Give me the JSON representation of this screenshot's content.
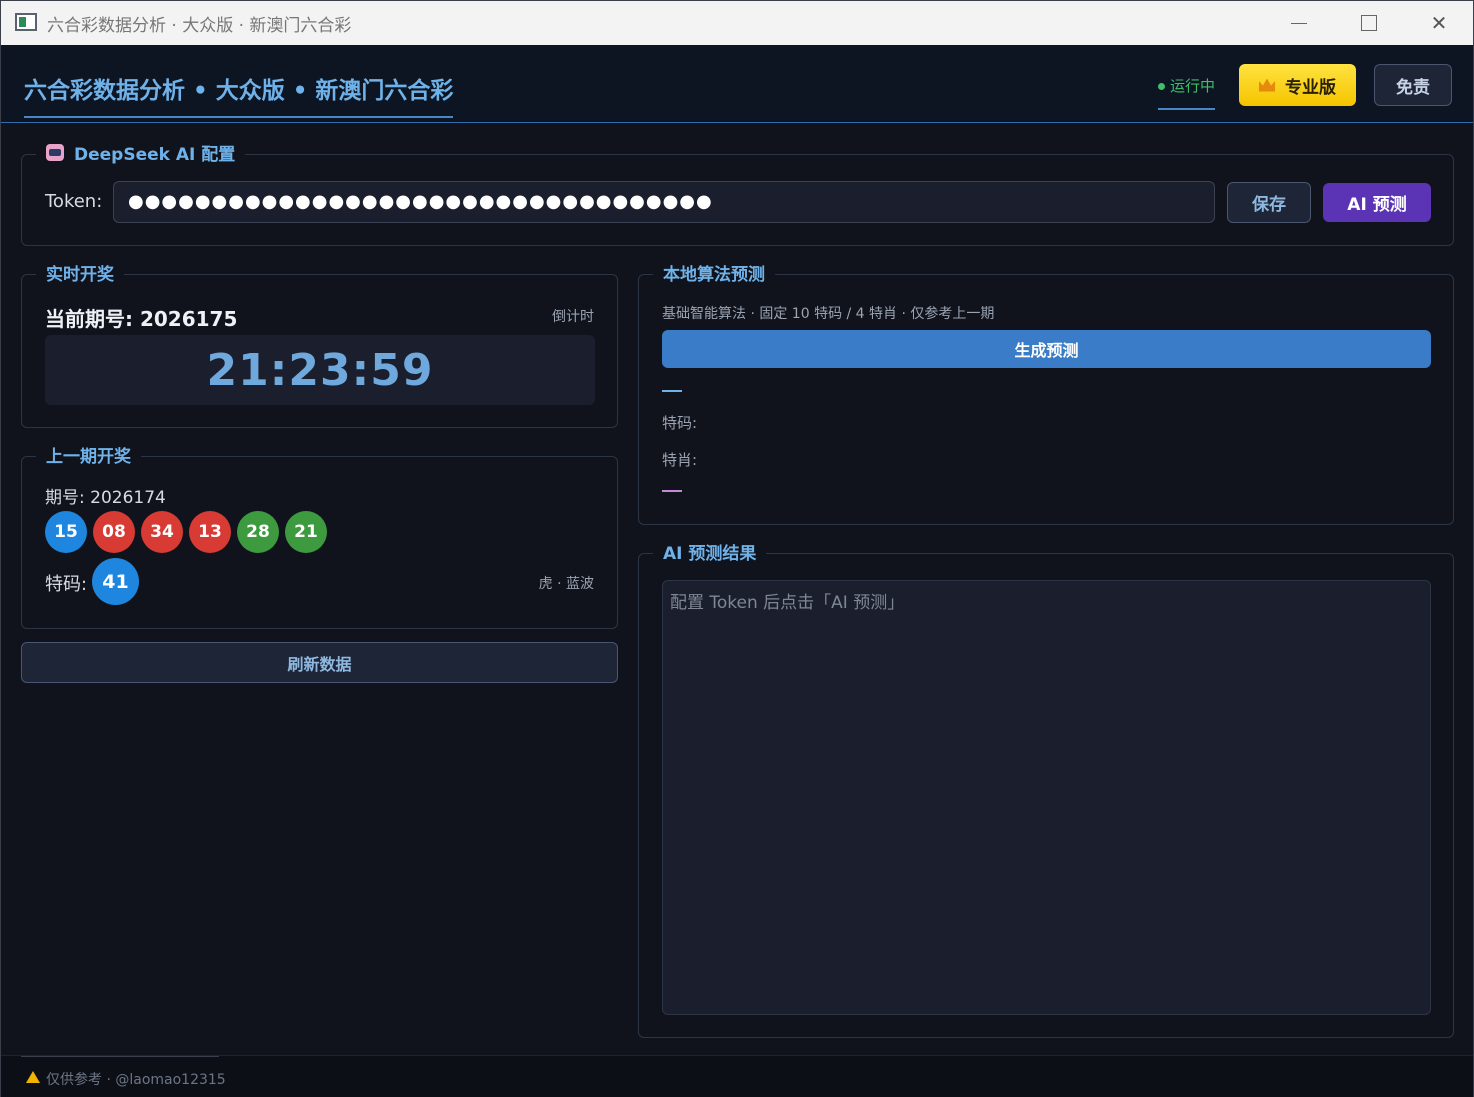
{
  "window": {
    "title": "六合彩数据分析 · 大众版 · 新澳门六合彩"
  },
  "header": {
    "title": "六合彩数据分析 • 大众版 • 新澳门六合彩",
    "status": "运行中",
    "pro_label": "专业版",
    "disclaimer_label": "免责"
  },
  "ai_config": {
    "title": "DeepSeek AI 配置",
    "token_label": "Token:",
    "token_value": "●●●●●●●●●●●●●●●●●●●●●●●●●●●●●●●●●●●",
    "save_label": "保存",
    "predict_label": "AI 预测"
  },
  "realtime": {
    "title": "实时开奖",
    "current_issue": "当前期号: 2026175",
    "countdown_label": "倒计时",
    "countdown": "21:23:59"
  },
  "last_draw": {
    "title": "上一期开奖",
    "issue": "期号: 2026174",
    "balls": [
      {
        "number": "15",
        "color": "#1e86de"
      },
      {
        "number": "08",
        "color": "#d83a34"
      },
      {
        "number": "34",
        "color": "#d83a34"
      },
      {
        "number": "13",
        "color": "#d83a34"
      },
      {
        "number": "28",
        "color": "#3e9a3e"
      },
      {
        "number": "21",
        "color": "#3e9a3e"
      }
    ],
    "special_label": "特码:",
    "special_number": "41",
    "special_color": "#1e86de",
    "zodiac": "虎 · 蓝波"
  },
  "refresh_label": "刷新数据",
  "local_prediction": {
    "title": "本地算法预测",
    "description": "基础智能算法 · 固定 10 特码 / 4 特肖 · 仅参考上一期",
    "generate_label": "生成预测",
    "special_code_label": "特码:",
    "special_zodiac_label": "特肖:"
  },
  "ai_result": {
    "title": "AI 预测结果",
    "placeholder": "配置 Token 后点击「AI 预测」"
  },
  "footer": {
    "text": "仅供参考 · @laomao12315"
  },
  "colors": {
    "accent": "#6fb2ea",
    "pro_button": "#f5c400",
    "ai_button": "#5a34b4",
    "generate_button": "#3a7cc7",
    "status_green": "#3fbf6a"
  }
}
